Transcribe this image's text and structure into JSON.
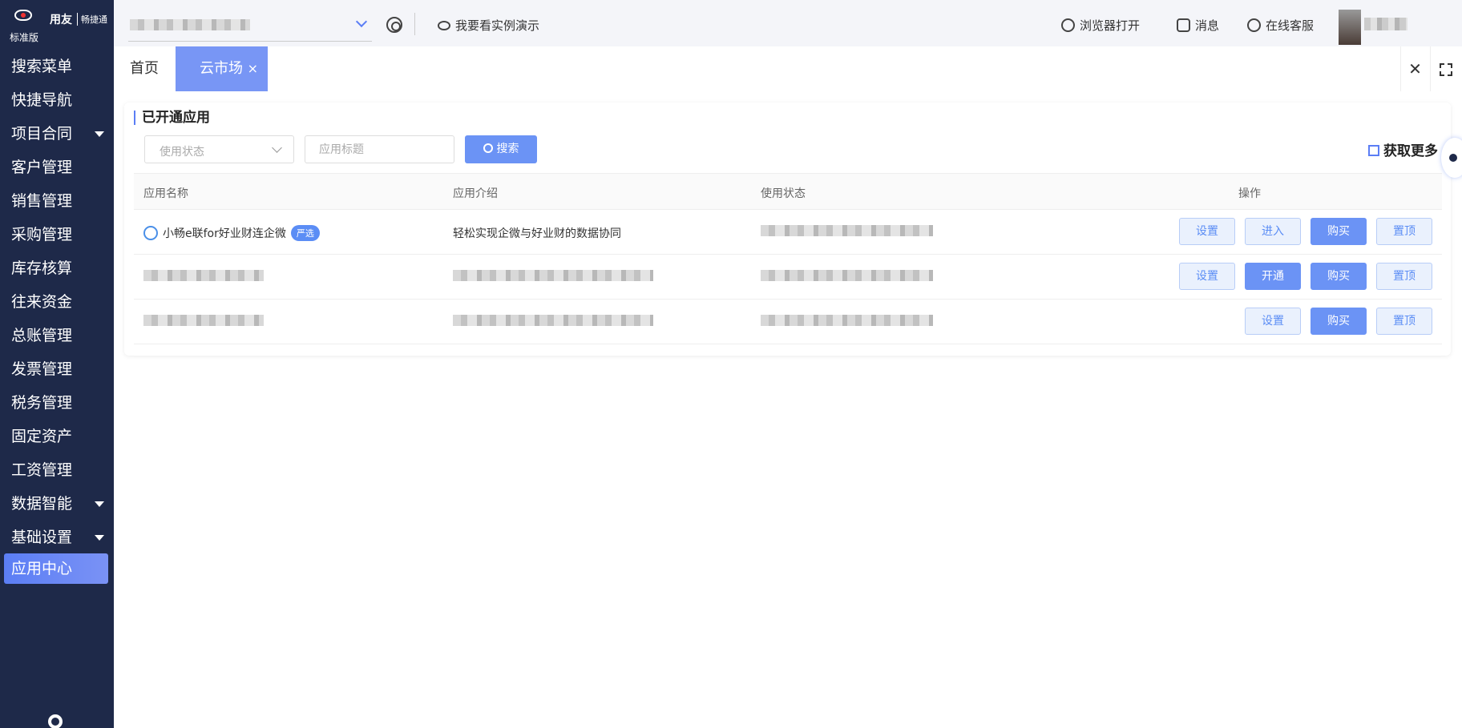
{
  "logo": {
    "brand": "用友",
    "brand_sub": "畅捷通",
    "edition": "标准版"
  },
  "sidebar": {
    "items": [
      {
        "label": "搜索菜单",
        "expand": false
      },
      {
        "label": "快捷导航",
        "expand": false
      },
      {
        "label": "项目合同",
        "expand": true
      },
      {
        "label": "客户管理",
        "expand": false
      },
      {
        "label": "销售管理",
        "expand": false
      },
      {
        "label": "采购管理",
        "expand": false
      },
      {
        "label": "库存核算",
        "expand": false
      },
      {
        "label": "往来资金",
        "expand": false
      },
      {
        "label": "总账管理",
        "expand": false
      },
      {
        "label": "发票管理",
        "expand": false
      },
      {
        "label": "税务管理",
        "expand": false
      },
      {
        "label": "固定资产",
        "expand": false
      },
      {
        "label": "工资管理",
        "expand": false
      },
      {
        "label": "数据智能",
        "expand": true
      },
      {
        "label": "基础设置",
        "expand": true
      },
      {
        "label": "应用中心",
        "expand": false,
        "active": true
      }
    ]
  },
  "topbar": {
    "demo_label": "我要看实例演示",
    "browser_open": "浏览器打开",
    "messages": "消息",
    "support": "在线客服"
  },
  "tabs": [
    {
      "label": "首页",
      "active": false
    },
    {
      "label": "云市场",
      "active": true,
      "close": "×"
    }
  ],
  "tab_controls": {
    "close_all": "✕"
  },
  "panel": {
    "title": "已开通应用",
    "filter_status_placeholder": "使用状态",
    "filter_title_placeholder": "应用标题",
    "search_label": "搜索",
    "get_more": "获取更多"
  },
  "table": {
    "headers": [
      "应用名称",
      "应用介绍",
      "使用状态",
      "操作"
    ],
    "rows": [
      {
        "name": "小畅e联for好业财连企微",
        "tag": "严选",
        "intro": "轻松实现企微与好业财的数据协同",
        "actions": [
          {
            "label": "设置",
            "primary": false
          },
          {
            "label": "进入",
            "primary": false
          },
          {
            "label": "购买",
            "primary": true
          },
          {
            "label": "置顶",
            "primary": false
          }
        ]
      },
      {
        "name": "",
        "tag": "",
        "intro": "",
        "actions": [
          {
            "label": "设置",
            "primary": false
          },
          {
            "label": "开通",
            "primary": true
          },
          {
            "label": "购买",
            "primary": true
          },
          {
            "label": "置顶",
            "primary": false
          }
        ]
      },
      {
        "name": "",
        "tag": "",
        "intro": "",
        "actions": [
          {
            "label": "设置",
            "primary": false
          },
          {
            "label": "购买",
            "primary": true
          },
          {
            "label": "置顶",
            "primary": false
          }
        ]
      }
    ]
  },
  "colors": {
    "sidebar_bg": "#1e2949",
    "accent": "#6b93f5",
    "tab_active": "#7896f5"
  }
}
